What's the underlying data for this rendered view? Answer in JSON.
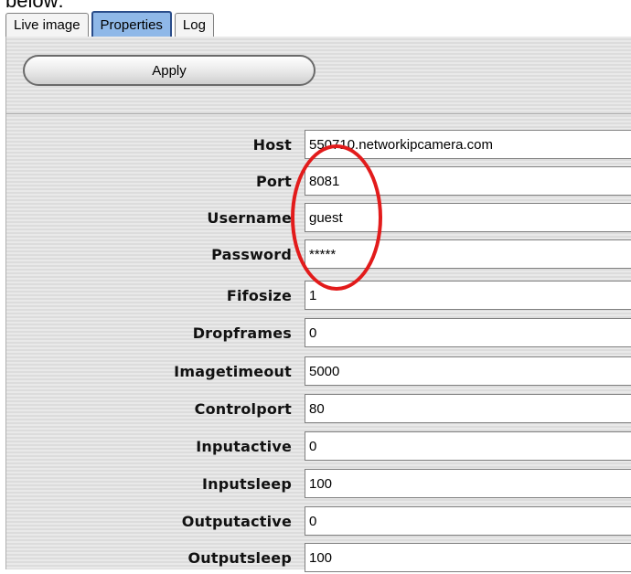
{
  "page": {
    "top_text": "below:"
  },
  "tabs": [
    {
      "label": "Live image",
      "active": false
    },
    {
      "label": "Properties",
      "active": true
    },
    {
      "label": "Log",
      "active": false
    }
  ],
  "toolbar": {
    "apply_label": "Apply"
  },
  "properties": [
    {
      "label": "Host",
      "value": "550710.networkipcamera.com"
    },
    {
      "label": "Port",
      "value": "8081"
    },
    {
      "label": "Username",
      "value": "guest"
    },
    {
      "label": "Password",
      "value": "*****"
    },
    {
      "label": "Fifosize",
      "value": "1"
    },
    {
      "label": "Dropframes",
      "value": "0"
    },
    {
      "label": "Imagetimeout",
      "value": "5000"
    },
    {
      "label": "Controlport",
      "value": "80"
    },
    {
      "label": "Inputactive",
      "value": "0"
    },
    {
      "label": "Inputsleep",
      "value": "100"
    },
    {
      "label": "Outputactive",
      "value": "0"
    },
    {
      "label": "Outputsleep",
      "value": "100"
    }
  ],
  "annotation": {
    "circle_color": "#e21b1b"
  }
}
